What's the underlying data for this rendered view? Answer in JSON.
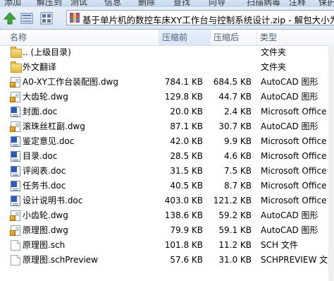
{
  "toolbar": {
    "items": [
      "添加",
      "解压到",
      "测试",
      "删除",
      "查找",
      "向导",
      "信息",
      "扫描病毒",
      "注释",
      "保护"
    ]
  },
  "address": {
    "path": "基于单片机的数控车床XY工作台与控制系统设计.zip - 解包大小为"
  },
  "columns": {
    "name": "名称",
    "size": "压缩前",
    "compressed": "压缩后",
    "type": "类型"
  },
  "files": [
    {
      "name": ".. (上级目录)",
      "size": "",
      "compressed": "",
      "type": "文件夹",
      "icon": "folder-icon"
    },
    {
      "name": "外文翻译",
      "size": "",
      "compressed": "",
      "type": "文件夹",
      "icon": "folder-icon"
    },
    {
      "name": "A0-XY工作台装配图.dwg",
      "size": "784.1 KB",
      "compressed": "684.5 KB",
      "type": "AutoCAD 图形",
      "icon": "dwg-icon"
    },
    {
      "name": "大齿轮.dwg",
      "size": "129.8 KB",
      "compressed": "44.7 KB",
      "type": "AutoCAD 图形",
      "icon": "dwg-icon"
    },
    {
      "name": "封面.doc",
      "size": "20.0 KB",
      "compressed": "2.4 KB",
      "type": "Microsoft Office",
      "icon": "doc-icon"
    },
    {
      "name": "滚珠丝杠副.dwg",
      "size": "87.1 KB",
      "compressed": "30.7 KB",
      "type": "AutoCAD 图形",
      "icon": "dwg-icon"
    },
    {
      "name": "鉴定意见.doc",
      "size": "42.0 KB",
      "compressed": "9.9 KB",
      "type": "Microsoft Office",
      "icon": "doc-icon"
    },
    {
      "name": "目录.doc",
      "size": "28.5 KB",
      "compressed": "4.6 KB",
      "type": "Microsoft Office",
      "icon": "doc-icon"
    },
    {
      "name": "评阅表.doc",
      "size": "31.5 KB",
      "compressed": "7.5 KB",
      "type": "Microsoft Office",
      "icon": "doc-icon"
    },
    {
      "name": "任务书.doc",
      "size": "40.5 KB",
      "compressed": "8.7 KB",
      "type": "Microsoft Office",
      "icon": "doc-icon"
    },
    {
      "name": "设计说明书.doc",
      "size": "403.0 KB",
      "compressed": "121.2 KB",
      "type": "Microsoft Office",
      "icon": "doc-icon"
    },
    {
      "name": "小齿轮.dwg",
      "size": "138.6 KB",
      "compressed": "59.2 KB",
      "type": "AutoCAD 图形",
      "icon": "dwg-icon"
    },
    {
      "name": "原理图.dwg",
      "size": "79.9 KB",
      "compressed": "59.1 KB",
      "type": "AutoCAD 图形",
      "icon": "dwg-icon"
    },
    {
      "name": "原理图.sch",
      "size": "101.8 KB",
      "compressed": "11.2 KB",
      "type": "SCH 文件",
      "icon": "sch-icon"
    },
    {
      "name": "原理图.schPreview",
      "size": "57.6 KB",
      "compressed": "31.0 KB",
      "type": "SCHPREVIEW 文件",
      "icon": "sch-icon"
    }
  ]
}
